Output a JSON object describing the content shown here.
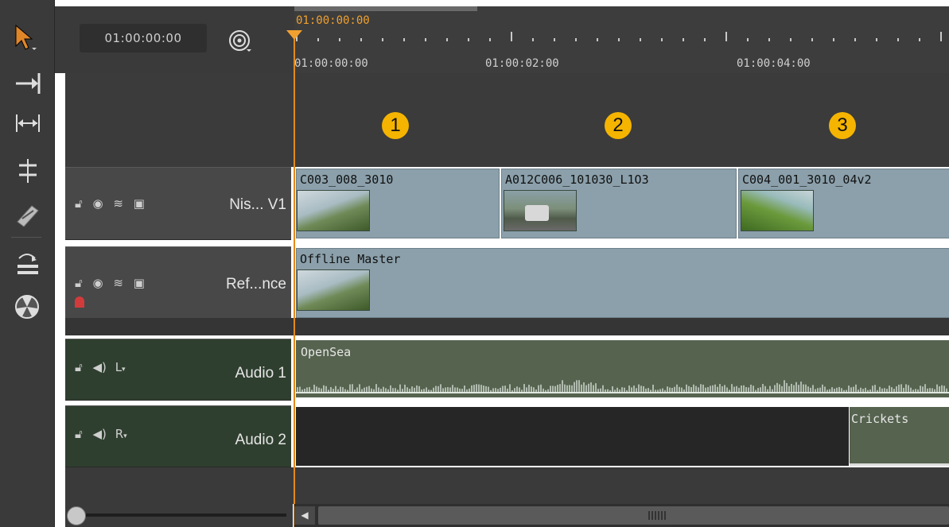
{
  "header": {
    "timecode": "01:00:00:00",
    "playhead_timecode": "01:00:00:00",
    "ruler_labels": [
      "01:00:00:00",
      "01:00:02:00",
      "01:00:04:00"
    ]
  },
  "markers": [
    "1",
    "2",
    "3"
  ],
  "tracks": {
    "video1": {
      "name": "Nis... V1"
    },
    "reference": {
      "name": "Ref...nce"
    },
    "audio1": {
      "name": "Audio 1",
      "channel": "L"
    },
    "audio2": {
      "name": "Audio 2",
      "channel": "R"
    }
  },
  "clips": {
    "v1": [
      "C003_008_3010",
      "A012C006_101030_L1O3",
      "C004_001_3010_04v2"
    ],
    "ref": "Offline Master",
    "a1": "OpenSea",
    "a2": "Crickets"
  },
  "icons": {
    "toolbar": [
      "pointer-icon",
      "track-select-forward-icon",
      "ripple-trim-icon",
      "slip-icon",
      "razor-icon",
      "insert-track-icon",
      "radiation-icon"
    ],
    "track": [
      "lock-icon",
      "eye-icon",
      "layers-icon",
      "disk-icon"
    ],
    "audio": [
      "lock-icon",
      "speaker-icon"
    ]
  },
  "colors": {
    "playhead": "#e48a1a",
    "marker": "#f5b400",
    "video_clip": "#8ba0ab",
    "audio_clip": "#56634f"
  }
}
